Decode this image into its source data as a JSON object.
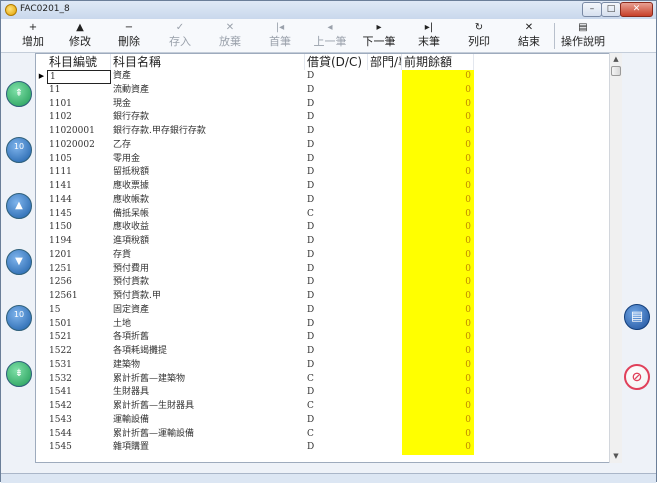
{
  "window": {
    "title": "FAC0201_8",
    "min": "–",
    "max": "□",
    "close": "✕"
  },
  "toolbar": {
    "items": [
      {
        "label": "增加",
        "icon": "+",
        "enabled": true
      },
      {
        "label": "修改",
        "icon": "▲",
        "enabled": true
      },
      {
        "label": "刪除",
        "icon": "−",
        "enabled": true
      },
      {
        "label": "存入",
        "icon": "✓",
        "enabled": false
      },
      {
        "label": "放棄",
        "icon": "✕",
        "enabled": false
      },
      {
        "label": "首筆",
        "icon": "|◂",
        "enabled": false
      },
      {
        "label": "上一筆",
        "icon": "◂",
        "enabled": false
      },
      {
        "label": "下一筆",
        "icon": "▸",
        "enabled": true
      },
      {
        "label": "末筆",
        "icon": "▸|",
        "enabled": true
      },
      {
        "label": "列印",
        "icon": "↻",
        "enabled": true
      },
      {
        "label": "結束",
        "icon": "✕",
        "enabled": true
      },
      {
        "label": "操作說明",
        "icon": "▤",
        "enabled": true
      }
    ]
  },
  "nav": {
    "first_icon": "⇞",
    "back10_label": "10",
    "prev_icon": "▲",
    "next_icon": "▼",
    "fwd10_label": "10",
    "last_icon": "⇟",
    "list_icon": "▤",
    "cancel_icon": "⊘"
  },
  "grid": {
    "headers": {
      "code": "科目編號",
      "name": "科目名稱",
      "dc": "借貸(D/C)",
      "dept": "部門/專案",
      "balance": "前期餘額"
    },
    "rows": [
      {
        "code": "1",
        "name": "資產",
        "dc": "D",
        "balance": "0"
      },
      {
        "code": "11",
        "name": "流動資產",
        "dc": "D",
        "balance": "0"
      },
      {
        "code": "1101",
        "name": "現金",
        "dc": "D",
        "balance": "0"
      },
      {
        "code": "1102",
        "name": "銀行存款",
        "dc": "D",
        "balance": "0"
      },
      {
        "code": "11020001",
        "name": "銀行存款.甲存銀行存款",
        "dc": "D",
        "balance": "0"
      },
      {
        "code": "11020002",
        "name": "乙存",
        "dc": "D",
        "balance": "0"
      },
      {
        "code": "1105",
        "name": "零用金",
        "dc": "D",
        "balance": "0"
      },
      {
        "code": "1111",
        "name": "留抵稅額",
        "dc": "D",
        "balance": "0"
      },
      {
        "code": "1141",
        "name": "應收票據",
        "dc": "D",
        "balance": "0"
      },
      {
        "code": "1144",
        "name": "應收帳款",
        "dc": "D",
        "balance": "0"
      },
      {
        "code": "1145",
        "name": "備抵呆帳",
        "dc": "C",
        "balance": "0"
      },
      {
        "code": "1150",
        "name": "應收收益",
        "dc": "D",
        "balance": "0"
      },
      {
        "code": "1194",
        "name": "進項稅額",
        "dc": "D",
        "balance": "0"
      },
      {
        "code": "1201",
        "name": "存貨",
        "dc": "D",
        "balance": "0"
      },
      {
        "code": "1251",
        "name": "預付費用",
        "dc": "D",
        "balance": "0"
      },
      {
        "code": "1256",
        "name": "預付貨款",
        "dc": "D",
        "balance": "0"
      },
      {
        "code": "12561",
        "name": "預付貨款.甲",
        "dc": "D",
        "balance": "0"
      },
      {
        "code": "15",
        "name": "固定資產",
        "dc": "D",
        "balance": "0"
      },
      {
        "code": "1501",
        "name": "土地",
        "dc": "D",
        "balance": "0"
      },
      {
        "code": "1521",
        "name": "各項折舊",
        "dc": "D",
        "balance": "0"
      },
      {
        "code": "1522",
        "name": "各項耗竭攤提",
        "dc": "D",
        "balance": "0"
      },
      {
        "code": "1531",
        "name": "建築物",
        "dc": "D",
        "balance": "0"
      },
      {
        "code": "1532",
        "name": "累計折舊—建築物",
        "dc": "C",
        "balance": "0"
      },
      {
        "code": "1541",
        "name": "生財器具",
        "dc": "D",
        "balance": "0"
      },
      {
        "code": "1542",
        "name": "累計折舊—生財器具",
        "dc": "C",
        "balance": "0"
      },
      {
        "code": "1543",
        "name": "運輸設備",
        "dc": "D",
        "balance": "0"
      },
      {
        "code": "1544",
        "name": "累計折舊—運輸設備",
        "dc": "C",
        "balance": "0"
      },
      {
        "code": "1545",
        "name": "雜項購置",
        "dc": "D",
        "balance": "0"
      }
    ],
    "current_row_indicator": "▶"
  },
  "scroll": {
    "up": "▲",
    "down": "▼"
  },
  "colors": {
    "balance_bg": "#ffff00",
    "accent": "#1d5fa8"
  }
}
